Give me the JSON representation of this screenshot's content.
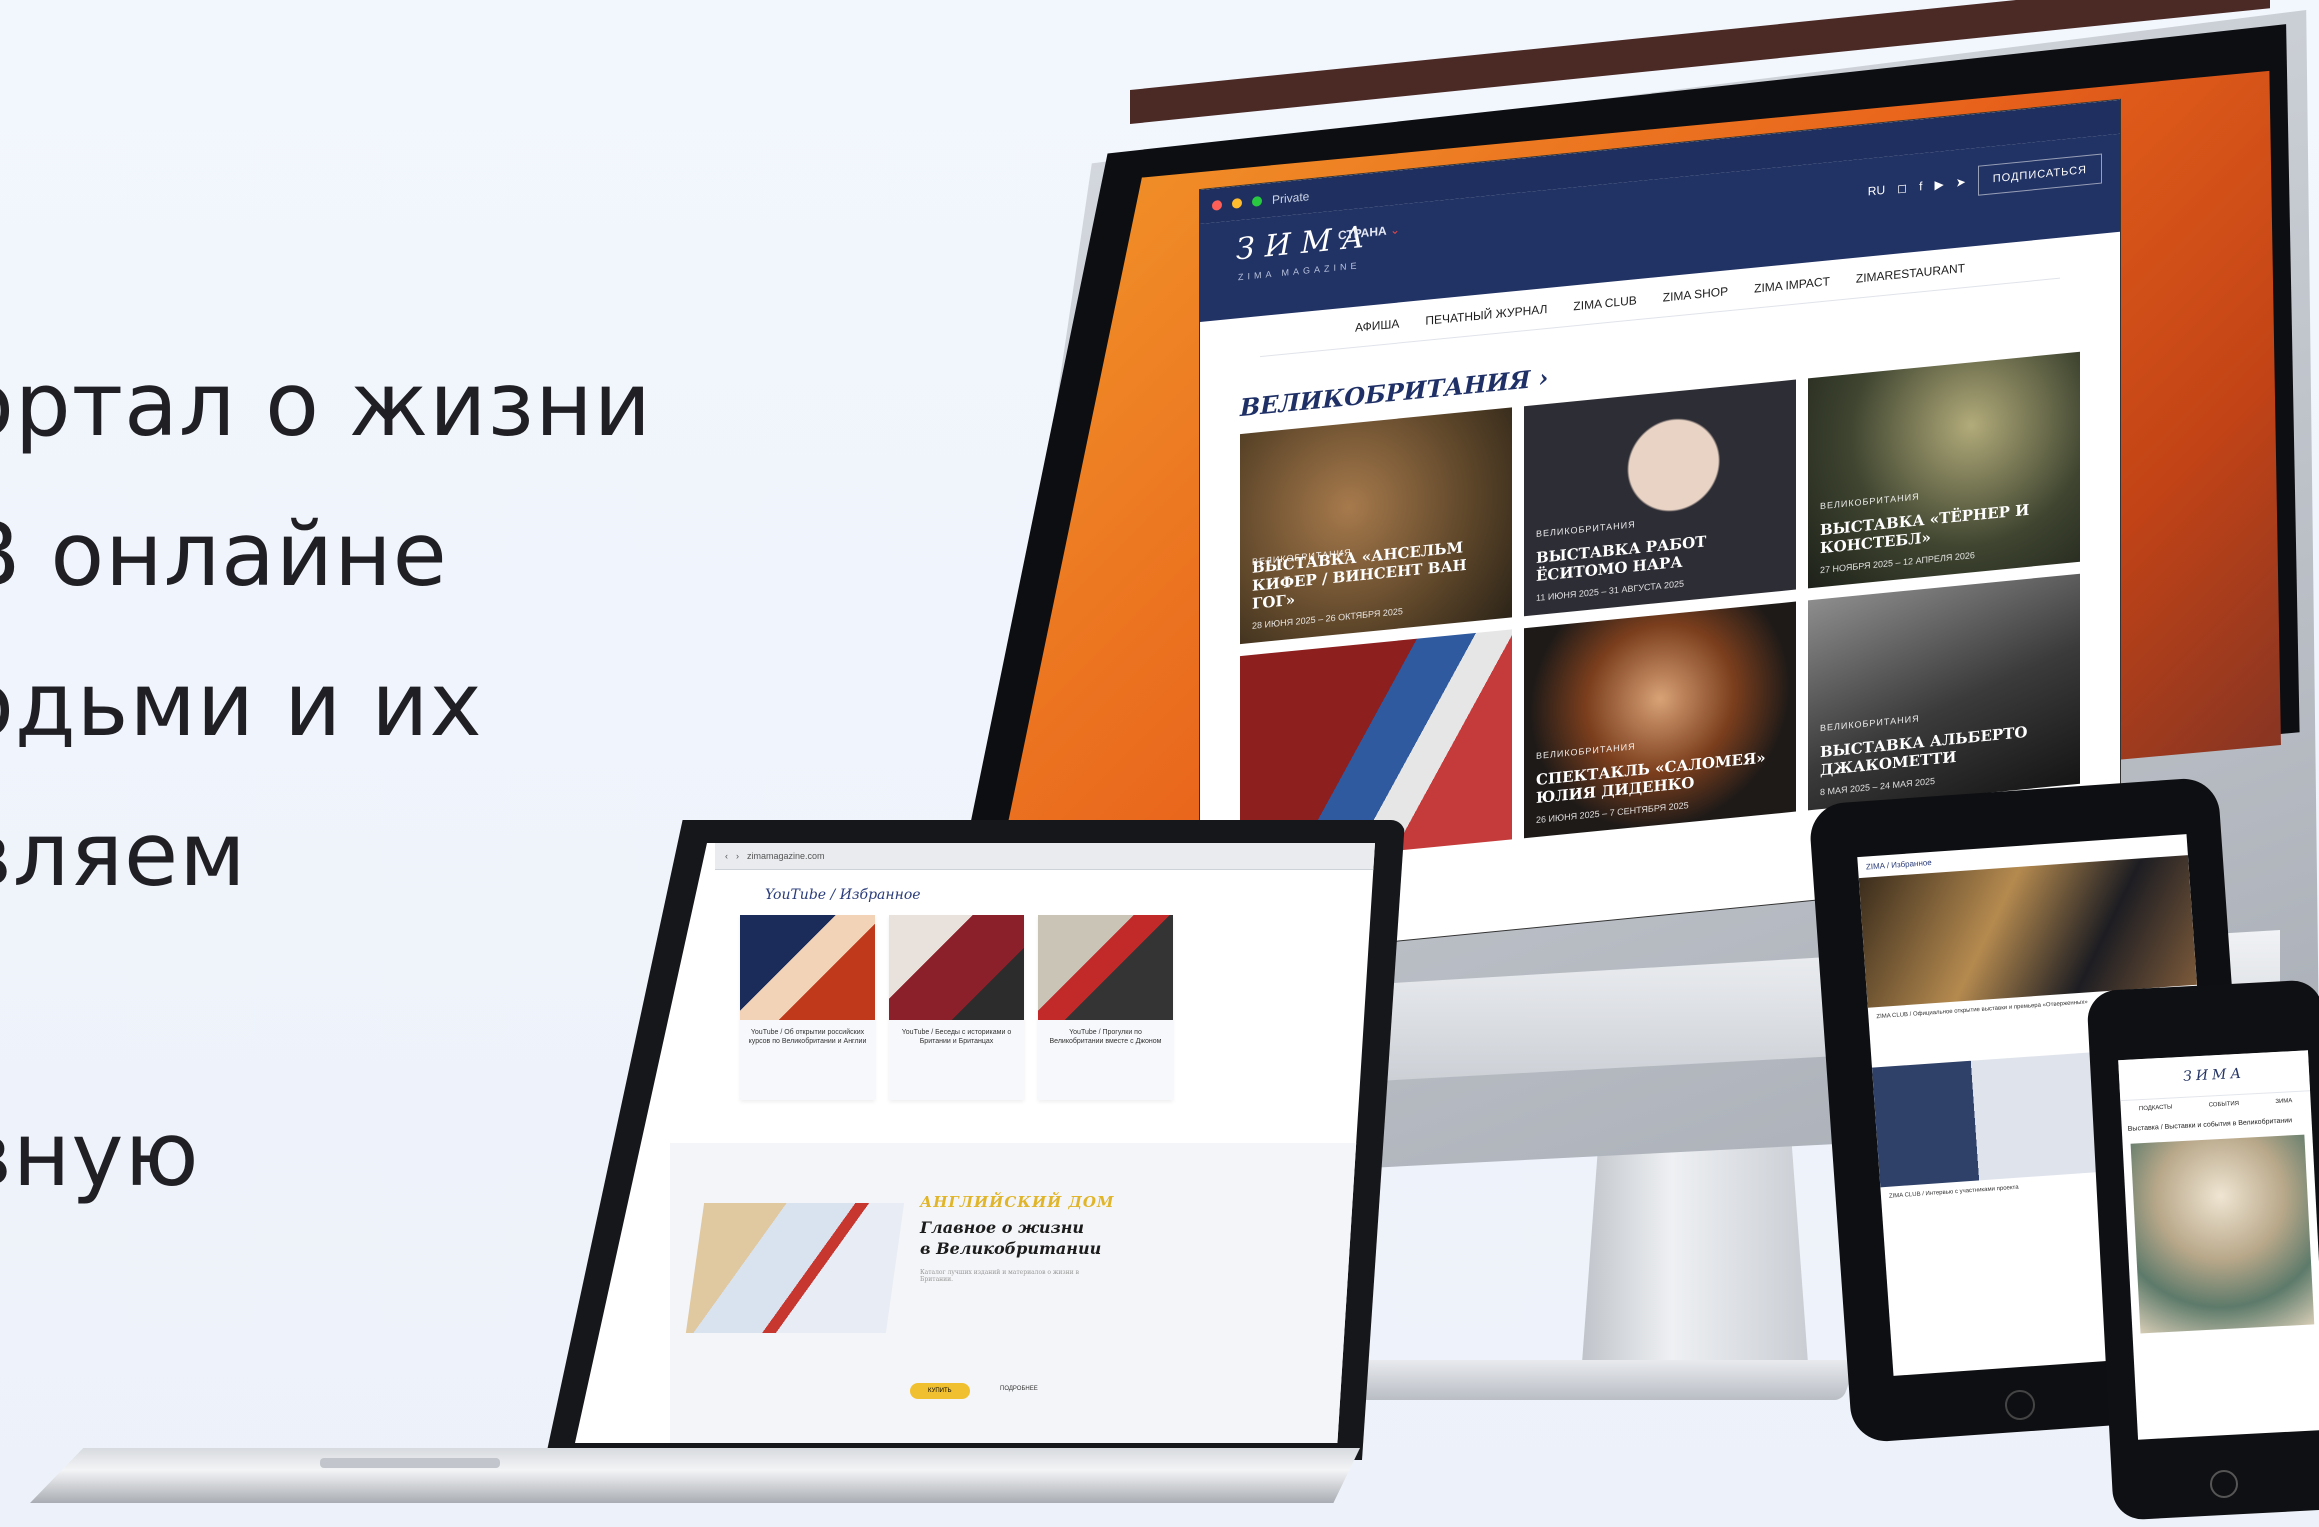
{
  "hero": {
    "lines": [
      "ортал о жизни",
      "В онлайне",
      "одьми и их",
      "вляем",
      "",
      "вную"
    ]
  },
  "desktop_site": {
    "tab_label": "Private",
    "logo": "ЗИМА",
    "logo_sub": "ZIMA MAGAZINE",
    "country_label": "СТРАНА",
    "lang": "RU",
    "subscribe": "ПОДПИСАТЬСЯ",
    "nav": [
      "АФИША",
      "ПЕЧАТНЫЙ ЖУРНАЛ",
      "ZIMA CLUB",
      "ZIMA SHOP",
      "ZIMA IMPACT",
      "ZIMARESTAURANT"
    ],
    "section_title": "ВЕЛИКОБРИТАНИЯ ›",
    "cards": [
      {
        "kicker": "ВЕЛИКОБРИТАНИЯ",
        "title": "ВЫСТАВКА «АНСЕЛЬМ КИФЕР / ВИНСЕНТ ВАН ГОГ»",
        "date": "28 ИЮНЯ 2025 – 26 ОКТЯБРЯ 2025"
      },
      {
        "kicker": "ВЕЛИКОБРИТАНИЯ",
        "title": "ВЫСТАВКА РАБОТ ЁСИТОМО НАРА",
        "date": "11 ИЮНЯ 2025 – 31 АВГУСТА 2025"
      },
      {
        "kicker": "ВЕЛИКОБРИТАНИЯ",
        "title": "ВЫСТАВКА «ТЁРНЕР И КОНСТЕБЛ»",
        "date": "27 НОЯБРЯ 2025 – 12 АПРЕЛЯ 2026"
      },
      {
        "kicker": "",
        "title": "",
        "date": ""
      },
      {
        "kicker": "ВЕЛИКОБРИТАНИЯ",
        "title": "СПЕКТАКЛЬ «САЛОМЕЯ» ЮЛИЯ ДИДЕНКО",
        "date": "26 ИЮНЯ 2025 – 7 СЕНТЯБРЯ 2025"
      },
      {
        "kicker": "ВЕЛИКОБРИТАНИЯ",
        "title": "ВЫСТАВКА АЛЬБЕРТО ДЖАКОМЕТТИ",
        "date": "8 МАЯ 2025 – 24 МАЯ 2025"
      }
    ]
  },
  "laptop_site": {
    "url": "zimamagazine.com",
    "section": "YouTube / Избранное",
    "cards": [
      {
        "caption": "YouTube / Об открытии российских курсов по Великобритании и Англии"
      },
      {
        "caption": "YouTube / Беседы с историками о Британии и Британцах"
      },
      {
        "caption": "YouTube / Прогулки по Великобритании вместе с Джоном"
      }
    ],
    "promo_kicker": "АНГЛИЙСКИЙ ДОМ",
    "promo_title_1": "Главное о жизни",
    "promo_title_2": "в Великобритании",
    "promo_text": "Каталог лучших изданий и материалов о жизни в Британии.",
    "buy_button": "КУПИТЬ",
    "more_link": "ПОДРОБНЕЕ"
  },
  "tablet_site": {
    "header": "ZIMA / Избранное",
    "caption_1": "ZIMA CLUB / Официальное открытие выставки и премьера «Отверженных»",
    "caption_2": "ZIMA CLUB / Интервью с участниками проекта"
  },
  "phone_site": {
    "logo": "ЗИМА",
    "nav": [
      "ПОДКАСТЫ",
      "СОБЫТИЯ",
      "ЗИМА"
    ],
    "caption": "Выставка / Выставки и события в Великобритании"
  },
  "colors": {
    "navy": "#213264",
    "accent_red": "#e04747",
    "gold": "#e0b52a"
  }
}
